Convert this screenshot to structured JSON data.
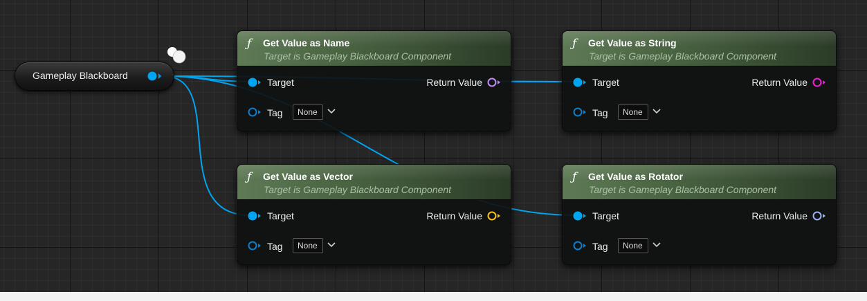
{
  "graph": {
    "variable": {
      "label": "Gameplay Blackboard"
    },
    "nodes": [
      {
        "icon": "ƒ",
        "title": "Get Value as Name",
        "subtitle": "Target is Gameplay Blackboard Component",
        "target_label": "Target",
        "return_label": "Return Value",
        "return_color": "#c58af5",
        "tag_label": "Tag",
        "tag_value": "None"
      },
      {
        "icon": "ƒ",
        "title": "Get Value as String",
        "subtitle": "Target is Gameplay Blackboard Component",
        "target_label": "Target",
        "return_label": "Return Value",
        "return_color": "#f01fd6",
        "tag_label": "Tag",
        "tag_value": "None"
      },
      {
        "icon": "ƒ",
        "title": "Get Value as Vector",
        "subtitle": "Target is Gameplay Blackboard Component",
        "target_label": "Target",
        "return_label": "Return Value",
        "return_color": "#f5c517",
        "tag_label": "Tag",
        "tag_value": "None"
      },
      {
        "icon": "ƒ",
        "title": "Get Value as Rotator",
        "subtitle": "Target is Gameplay Blackboard Component",
        "target_label": "Target",
        "return_label": "Return Value",
        "return_color": "#9fb1f5",
        "tag_label": "Tag",
        "tag_value": "None"
      }
    ]
  },
  "colors": {
    "object_pin": "#00a4f0",
    "tag_pin": "#0b7fd0",
    "function_header": "#5e7a55"
  }
}
